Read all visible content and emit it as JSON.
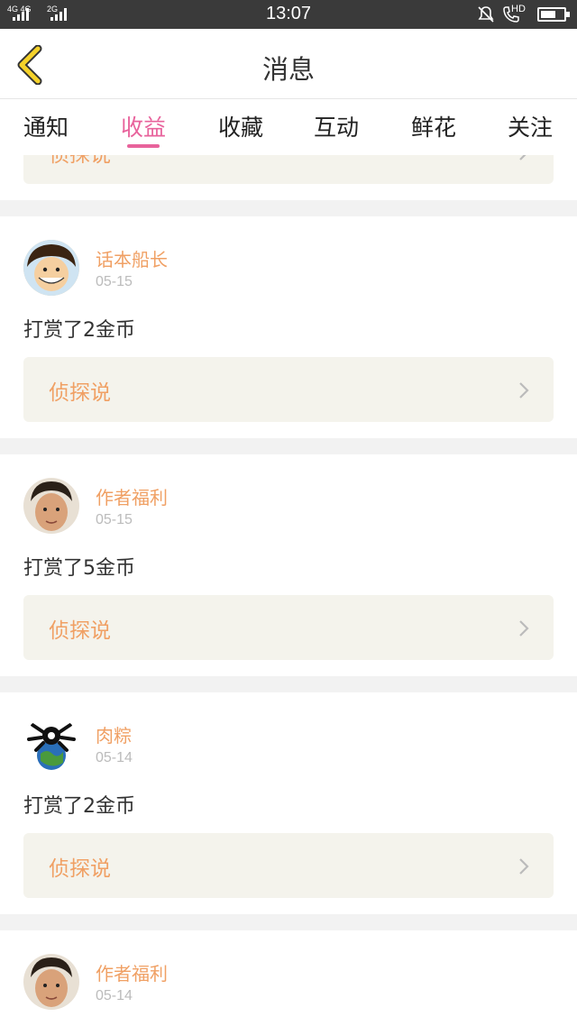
{
  "status_bar": {
    "time": "13:07",
    "network_left": "4G 4G",
    "network_right": "2G",
    "hd_label": "HD"
  },
  "header": {
    "title": "消息",
    "back_icon": "chevron-left-icon"
  },
  "tabs": [
    {
      "label": "通知"
    },
    {
      "label": "收益",
      "active": true
    },
    {
      "label": "收藏"
    },
    {
      "label": "互动"
    },
    {
      "label": "鲜花"
    },
    {
      "label": "关注"
    }
  ],
  "partial_card": {
    "link_text": "侦探说"
  },
  "messages": [
    {
      "user": "话本船长",
      "date": "05-15",
      "text": "打赏了2金币",
      "link_text": "侦探说"
    },
    {
      "user": "作者福利",
      "date": "05-15",
      "text": "打赏了5金币",
      "link_text": "侦探说"
    },
    {
      "user": "肉粽",
      "date": "05-14",
      "text": "打赏了2金币",
      "link_text": "侦探说"
    },
    {
      "user": "作者福利",
      "date": "05-14"
    }
  ],
  "colors": {
    "accent": "#e8639c",
    "name": "#f0a064",
    "link_bg": "#f4f3ec"
  }
}
